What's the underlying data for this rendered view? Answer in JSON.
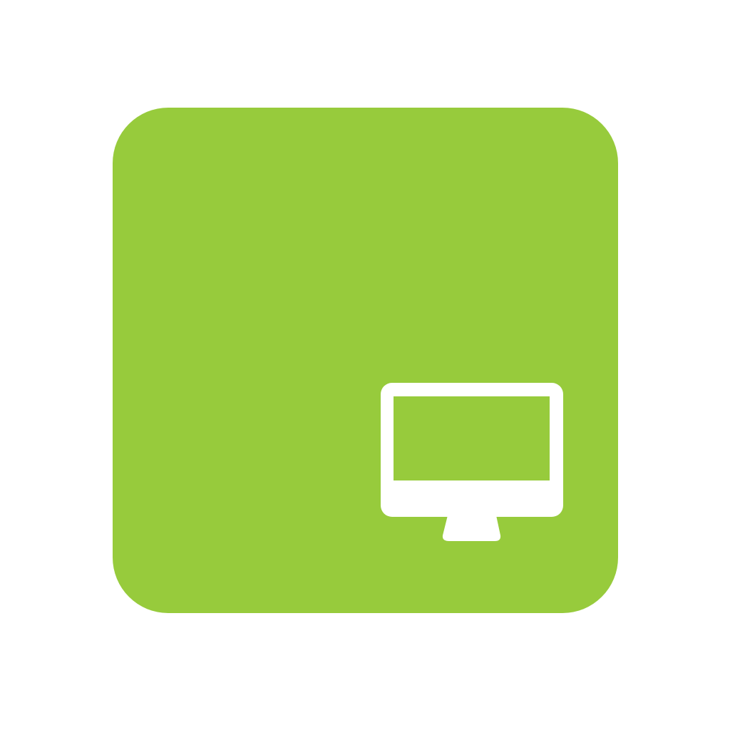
{
  "app_icon": {
    "icon": "desktop-monitor-icon",
    "background_color": "#97cb3c",
    "glyph_color": "#ffffff",
    "page_background": "#ffffff"
  }
}
